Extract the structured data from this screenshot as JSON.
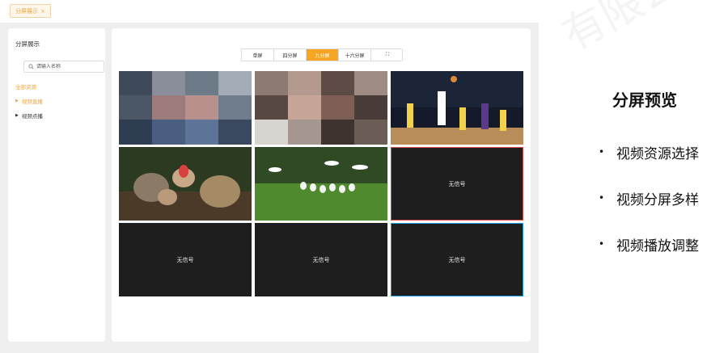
{
  "tab": {
    "label": "分屏展示",
    "close": "×"
  },
  "sidebar": {
    "title": "分屏展示",
    "search_placeholder": "请输入名称",
    "all_resources": "全部资源",
    "items": [
      {
        "label": "视频直播",
        "caret": "▶"
      },
      {
        "label": "视频点播",
        "caret": "▶"
      }
    ]
  },
  "toolbar": {
    "modes": [
      {
        "label": "单屏"
      },
      {
        "label": "四分屏"
      },
      {
        "label": "九分屏",
        "active": true
      },
      {
        "label": "十六分屏"
      }
    ],
    "fullscreen_icon": "⛶"
  },
  "grid": {
    "no_signal": "无信号",
    "cells": [
      {
        "kind": "video",
        "scene": "mosaic-face"
      },
      {
        "kind": "video",
        "scene": "mosaic-person"
      },
      {
        "kind": "video",
        "scene": "basketball"
      },
      {
        "kind": "video",
        "scene": "birds-nest"
      },
      {
        "kind": "video",
        "scene": "egrets"
      },
      {
        "kind": "empty",
        "border": "#e04a4a"
      },
      {
        "kind": "empty"
      },
      {
        "kind": "empty"
      },
      {
        "kind": "empty",
        "border": "#1e9de6"
      }
    ]
  },
  "colors": {
    "accent": "#f5a623",
    "app_bg": "#efefef",
    "cell_bg": "#1e1e1e"
  },
  "right_panel": {
    "title": "分屏预览",
    "bullet": "•",
    "points": [
      "视频资源选择",
      "视频分屏多样",
      "视频播放调整"
    ],
    "watermark": "有限公司"
  }
}
